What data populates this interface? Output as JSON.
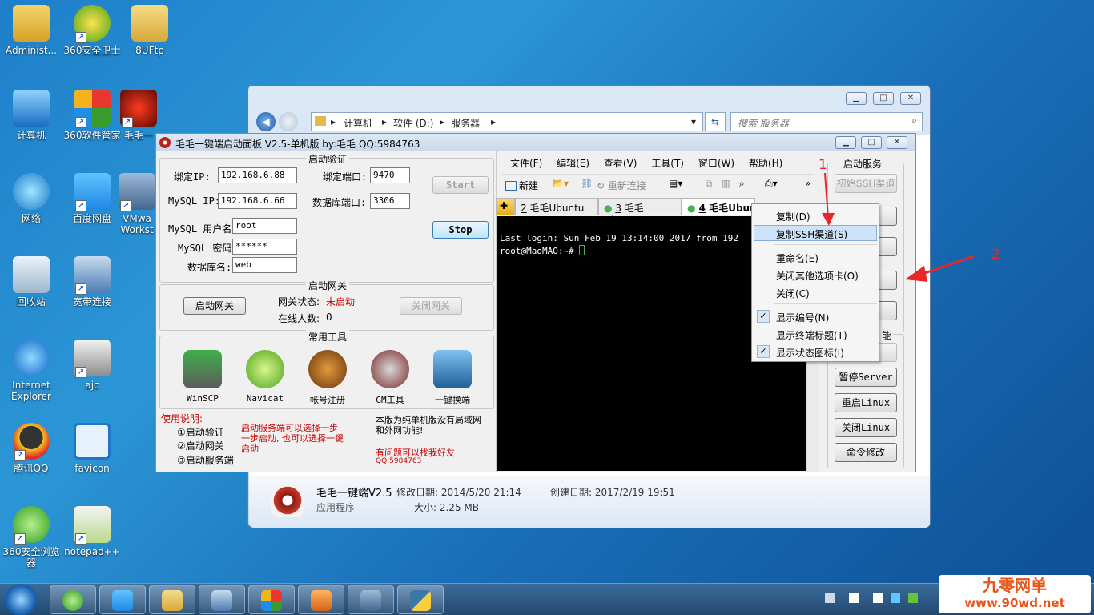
{
  "desktop": {
    "icons": [
      {
        "label": "Administ..."
      },
      {
        "label": "360安全卫士"
      },
      {
        "label": "8UFtp"
      },
      {
        "label": "计算机"
      },
      {
        "label": "360软件管家"
      },
      {
        "label": "毛毛一"
      },
      {
        "label": "网络"
      },
      {
        "label": "百度网盘"
      },
      {
        "label": "VMwa Workst"
      },
      {
        "label": "回收站"
      },
      {
        "label": "宽带连接"
      },
      {
        "label": "Internet Explorer"
      },
      {
        "label": "ajc"
      },
      {
        "label": "腾讯QQ"
      },
      {
        "label": "favicon"
      },
      {
        "label": "360安全浏览器"
      },
      {
        "label": "notepad++"
      }
    ]
  },
  "explorer": {
    "crumbs": [
      "计算机",
      "软件 (D:)",
      "服务器"
    ],
    "search_placeholder": "搜索 服务器",
    "details": {
      "name": "毛毛一键端V2.5",
      "modified_label": "修改日期: 2014/5/20 21:14",
      "created_label": "创建日期: 2017/2/19 19:51",
      "type": "应用程序",
      "size_label": "大小: 2.25 MB"
    }
  },
  "app": {
    "title": "毛毛一键端启动面板 V2.5-单机版 by:毛毛  QQ:5984763",
    "auth": {
      "group_title": "启动验证",
      "bind_ip_label": "绑定IP:",
      "bind_ip": "192.168.6.88",
      "bind_port_label": "绑定端口:",
      "bind_port": "9470",
      "mysql_ip_label": "MySQL IP:",
      "mysql_ip": "192.168.6.66",
      "db_port_label": "数据库端口:",
      "db_port": "3306",
      "mysql_user_label": "MySQL 用户名:",
      "mysql_user": "root",
      "mysql_pwd_label": "MySQL 密码:",
      "mysql_pwd": "******",
      "db_name_label": "数据库名:",
      "db_name": "web",
      "start": "Start",
      "stop": "Stop"
    },
    "gateway": {
      "group_title": "启动网关",
      "start_btn": "启动网关",
      "status_label": "网关状态:",
      "status_value": "未启动",
      "online_label": "在线人数:",
      "online_value": "0",
      "close_btn": "关闭网关"
    },
    "tools": {
      "group_title": "常用工具",
      "items": [
        "WinSCP",
        "Navicat",
        "帐号注册",
        "GM工具",
        "一键换端"
      ]
    },
    "usage": {
      "title": "使用说明:",
      "steps": [
        "①启动验证",
        "②启动网关",
        "③启动服务端"
      ],
      "note1": "启动服务端可以选择一步一步启动, 也可以选择一键启动",
      "note2": "本版为纯单机版没有局域网和外网功能!",
      "note3": "有问题可以找我好友",
      "qq": "QQ:5984763"
    },
    "terminal": {
      "menu": [
        "文件(F)",
        "编辑(E)",
        "查看(V)",
        "工具(T)",
        "窗口(W)",
        "帮助(H)"
      ],
      "toolbar": {
        "new": "新建",
        "reconnect": "重新连接"
      },
      "tabs": [
        {
          "num": "2",
          "name": "毛毛Ubuntu"
        },
        {
          "num": "3",
          "name": "毛毛Ubuntu"
        },
        {
          "num": "4",
          "name": "毛毛Ubun"
        }
      ],
      "lines": [
        "Last login: Sun Feb 19 13:14:00 2017 from 192",
        "root@MaoMAO:~# "
      ]
    },
    "context_menu": {
      "items": [
        {
          "label": "复制(D)"
        },
        {
          "label": "复制SSH渠道(S)",
          "highlighted": true
        },
        {
          "label": "重命名(E)"
        },
        {
          "label": "关闭其他选项卡(O)"
        },
        {
          "label": "关闭(C)"
        },
        {
          "label": "显示编号(N)",
          "checked": true
        },
        {
          "label": "显示终端标题(T)",
          "checked": false
        },
        {
          "label": "显示状态图标(I)",
          "checked": true
        }
      ]
    },
    "right_panel": {
      "group_title": "启动服务",
      "ssh_btn": "初始SSH渠道",
      "group2_title": "能",
      "buttons": [
        "暂停Server",
        "重启Linux",
        "关闭Linux",
        "命令修改"
      ]
    },
    "annotations": {
      "a1": "1",
      "a2": "2"
    }
  },
  "watermark": {
    "line1": "九零网单",
    "line2": "www.90wd.net"
  }
}
